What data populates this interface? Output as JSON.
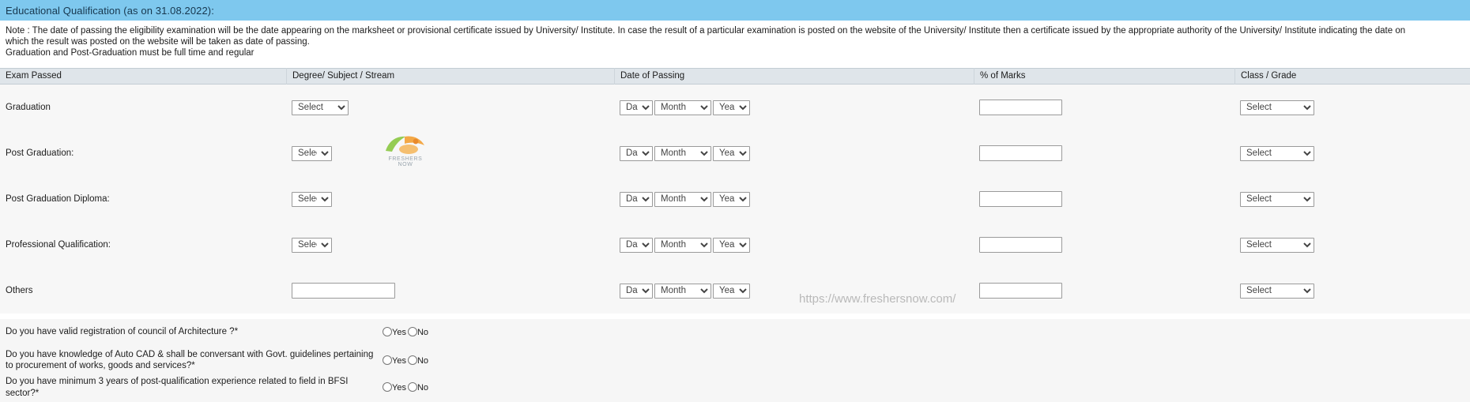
{
  "section": {
    "title": "Educational Qualification (as on 31.08.2022):",
    "bar_color": "#7ec8ee"
  },
  "note": {
    "line1": "Note : The date of passing the eligibility examination will be the date appearing on the marksheet or provisional certificate issued by University/ Institute. In case the result of a particular examination is posted on the website of the University/ Institute then a certificate issued by the appropriate authority of the University/ Institute indicating the date on",
    "line2": "which the result was posted on the website will be taken as date of passing.",
    "line3": "Graduation and Post-Graduation must be full time and regular"
  },
  "table": {
    "headers": {
      "exam": "Exam Passed",
      "degree": "Degree/ Subject / Stream",
      "date": "Date of Passing",
      "marks": "% of Marks",
      "class": "Class / Grade"
    },
    "placeholders": {
      "select": "Select",
      "day": "Day",
      "month": "Month",
      "year": "Year",
      "marks": "",
      "others_text": ""
    },
    "rows": [
      {
        "label": "Graduation",
        "degree_control": "select-wide",
        "degree_value": "Select",
        "day": "Day",
        "month": "Month",
        "year": "Year",
        "marks": "",
        "grade": "Select"
      },
      {
        "label": "Post Graduation:",
        "degree_control": "select",
        "degree_value": "Select",
        "day": "Day",
        "month": "Month",
        "year": "Year",
        "marks": "",
        "grade": "Select"
      },
      {
        "label": "Post Graduation Diploma:",
        "degree_control": "select",
        "degree_value": "Select",
        "day": "Day",
        "month": "Month",
        "year": "Year",
        "marks": "",
        "grade": "Select"
      },
      {
        "label": "Professional Qualification:",
        "degree_control": "select",
        "degree_value": "Select",
        "day": "Day",
        "month": "Month",
        "year": "Year",
        "marks": "",
        "grade": "Select"
      },
      {
        "label": "Others",
        "degree_control": "text",
        "degree_value": "",
        "day": "Day",
        "month": "Month",
        "year": "Year",
        "marks": "",
        "grade": "Select"
      }
    ]
  },
  "questions": {
    "items": [
      {
        "text": "Do you have valid registration of council of Architecture ?*",
        "yes": "Yes",
        "no": "No"
      },
      {
        "text": "Do you have knowledge of Auto CAD & shall be conversant with Govt. guidelines pertaining to procurement of works, goods and services?*",
        "yes": "Yes",
        "no": "No"
      },
      {
        "text": "Do you have minimum 3 years of post-qualification experience related to field in BFSI sector?*",
        "yes": "Yes",
        "no": "No"
      }
    ]
  },
  "watermarks": {
    "url": "https://www.freshersnow.com/",
    "brand": "FRESHERS NOW"
  }
}
